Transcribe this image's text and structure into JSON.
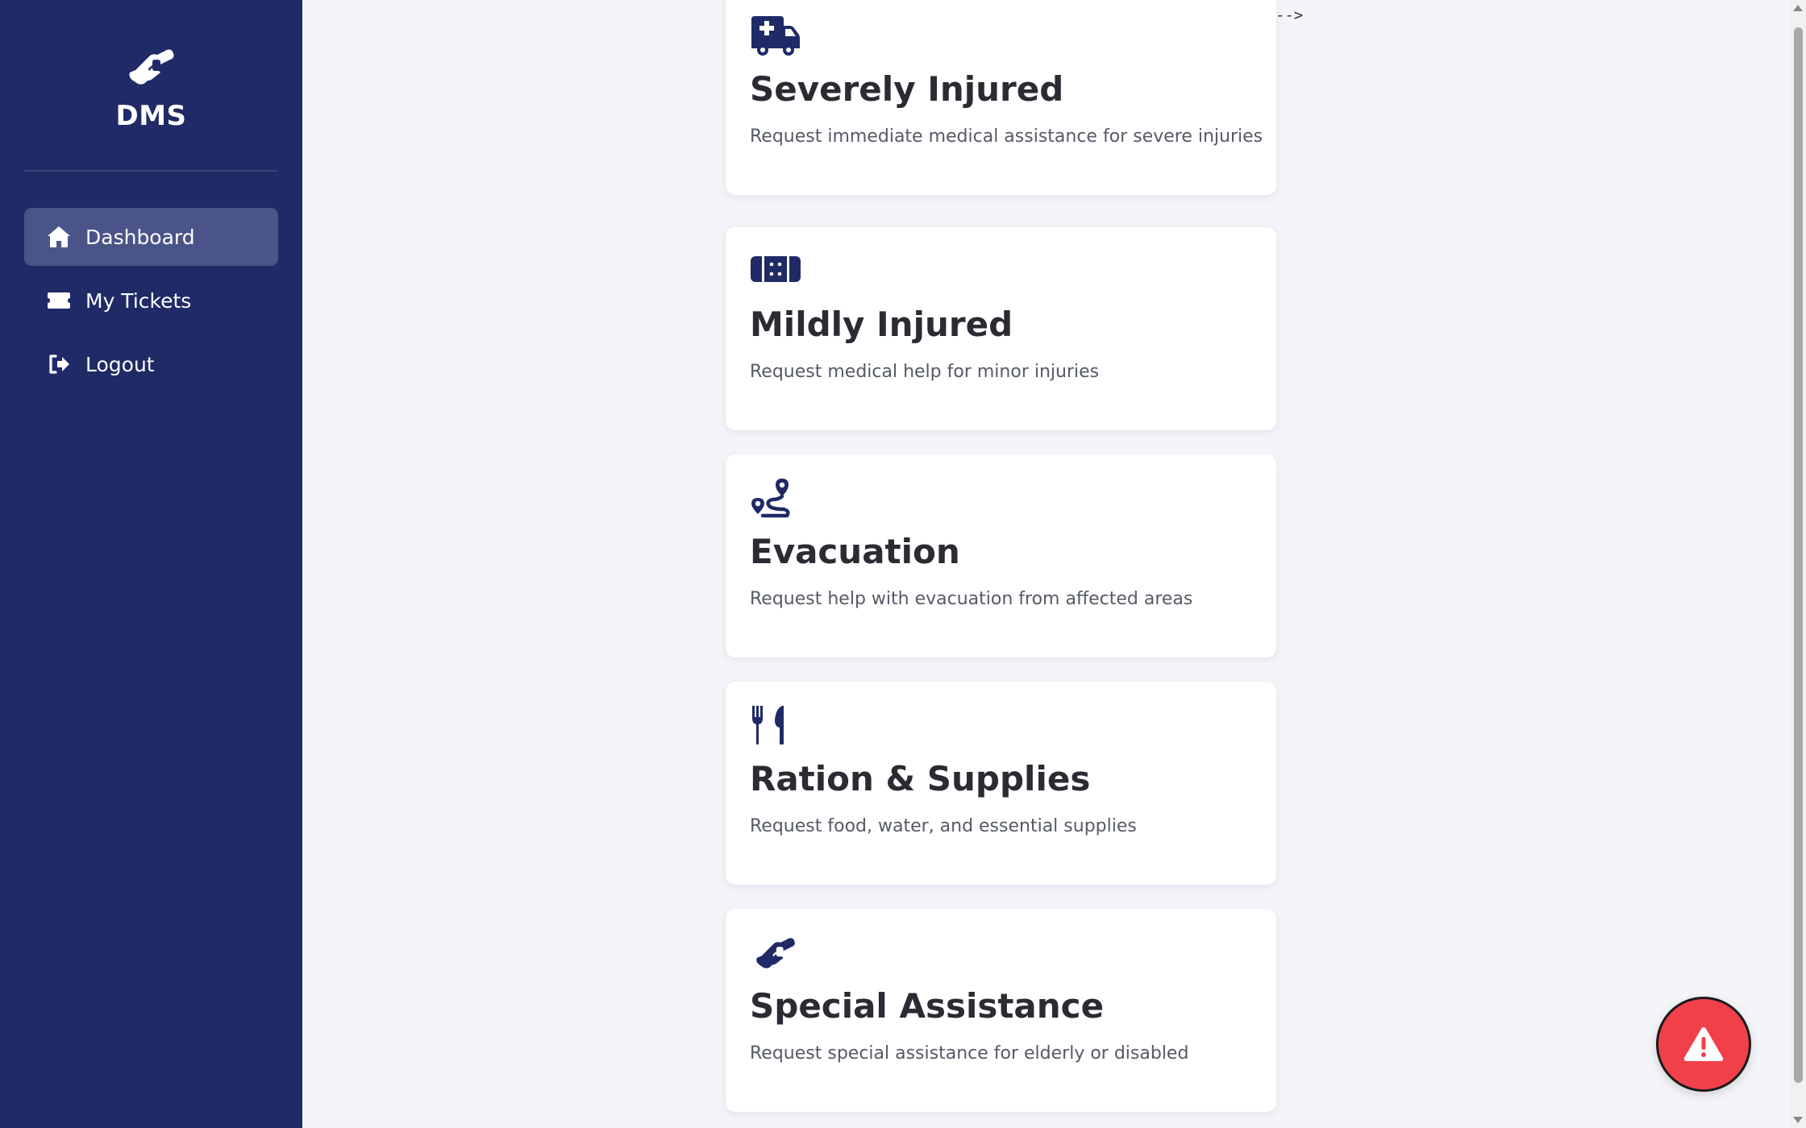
{
  "brand": {
    "name": "DMS",
    "icon": "handshake-icon"
  },
  "colors": {
    "sidebar_bg": "#1f2a66",
    "active_item_bg": "#4a5488",
    "icon_color": "#1f2a66",
    "page_bg": "#f4f5f9",
    "emergency_button": "#f1404a"
  },
  "sidebar": {
    "items": [
      {
        "label": "Dashboard",
        "icon": "home-icon",
        "active": true
      },
      {
        "label": "My Tickets",
        "icon": "ticket-icon",
        "active": false
      },
      {
        "label": "Logout",
        "icon": "logout-icon",
        "active": false
      }
    ]
  },
  "stray_text": "-->",
  "cards": [
    {
      "title": "Severely Injured",
      "description": "Request immediate medical assistance for severe injuries",
      "icon": "ambulance-icon"
    },
    {
      "title": "Mildly Injured",
      "description": "Request medical help for minor injuries",
      "icon": "bandage-icon"
    },
    {
      "title": "Evacuation",
      "description": "Request help with evacuation from affected areas",
      "icon": "route-icon"
    },
    {
      "title": "Ration & Supplies",
      "description": "Request food, water, and essential supplies",
      "icon": "utensils-icon"
    },
    {
      "title": "Special Assistance",
      "description": "Request special assistance for elderly or disabled",
      "icon": "handshake-icon"
    }
  ],
  "emergency_button": {
    "icon": "warning-icon"
  }
}
